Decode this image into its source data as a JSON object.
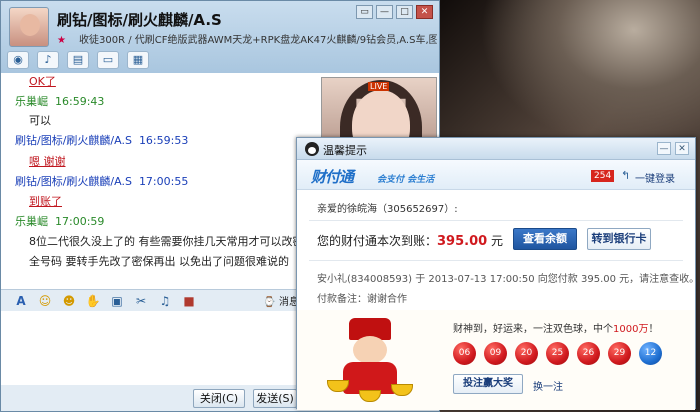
{
  "chat": {
    "title": "刷钻/图标/刷火麒麟/A.S",
    "subtitle": "收徒300R / 代刷CF绝版武器AWM天龙+RPK盘龙AK47火麒麟/9钻会员,A.S车,图标,...",
    "window_buttons": [
      "▭",
      "—",
      "□",
      "✕"
    ],
    "toolbar_icons": [
      "video-icon",
      "voice-icon",
      "file-icon",
      "screen-icon",
      "apps-icon"
    ],
    "messages": [
      {
        "sender": "",
        "time": "",
        "text": "OK了",
        "style": "red"
      },
      {
        "sender": "乐巢崛",
        "time": "16:59:43",
        "text": "可以",
        "style": "normal"
      },
      {
        "sender": "刷钻/图标/刷火麒麟/A.S",
        "time": "16:59:53",
        "text": "嗯 谢谢",
        "style": "red"
      },
      {
        "sender": "刷钻/图标/刷火麒麟/A.S",
        "time": "17:00:55",
        "text": "到账了",
        "style": "red"
      },
      {
        "sender": "乐巢崛",
        "time": "17:00:59",
        "text": "8位二代很久没上了的 有些需要你挂几天常用才可以改密保 我你说下 你密保",
        "style": "normal"
      },
      {
        "sender": "",
        "time": "",
        "text": "全号码 要转手先改了密保再出 以免出了问题很难说的",
        "style": "normal"
      }
    ],
    "video_badge": "LIVE",
    "history_label": "消息记录",
    "close_label": "关闭(C)",
    "send_label": "发送(S)"
  },
  "popup": {
    "title": "温馨提示",
    "logo": "财付通",
    "slogan": "会支付 会生活",
    "badge": "254",
    "login_label": "一键登录",
    "greeting": "亲爱的徐皖海（305652697）:",
    "notice_prefix": "您的财付通本次到账：",
    "amount": "395.00",
    "currency": "元",
    "check_balance_label": "查看余额",
    "to_bank_label": "转到银行卡",
    "detail": "安小礼(834008593) 于 2013-07-13 17:00:50 向您付款 395.00 元，请注意查收。",
    "memo": "付款备注：谢谢合作",
    "luck_prefix": "财神到，好运来，一注双色球，中个",
    "luck_highlight": "1000万",
    "luck_suffix": "！",
    "red_balls": [
      "06",
      "09",
      "20",
      "25",
      "26",
      "29"
    ],
    "blue_ball": "12",
    "bet_label": "投注赢大奖",
    "change_label": "换一注",
    "colors": {
      "accent": "#1f6fc8",
      "red": "#d0191e",
      "blue_ball": "#1f6fd1"
    }
  }
}
